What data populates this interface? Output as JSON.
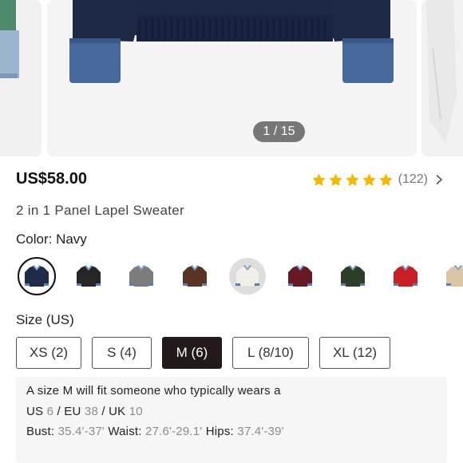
{
  "gallery": {
    "counter": "1 / 15"
  },
  "product": {
    "price": "US$58.00",
    "rating": {
      "stars": 5,
      "count": "(122)"
    },
    "title": "2 in 1 Panel Lapel Sweater"
  },
  "color": {
    "label": "Color: Navy",
    "swatches": [
      {
        "name": "Navy",
        "hex": "#1f2a48",
        "selected": true
      },
      {
        "name": "Black",
        "hex": "#262626"
      },
      {
        "name": "Grey",
        "hex": "#7c7c7c"
      },
      {
        "name": "Brown",
        "hex": "#5a3324"
      },
      {
        "name": "White",
        "hex": "#f1efe8"
      },
      {
        "name": "Burgundy",
        "hex": "#651a26"
      },
      {
        "name": "Green",
        "hex": "#2e3d26"
      },
      {
        "name": "Red",
        "hex": "#c81f26"
      },
      {
        "name": "Beige",
        "hex": "#d9c4a4"
      }
    ]
  },
  "size": {
    "label": "Size (US)",
    "options": [
      "XS (2)",
      "S (4)",
      "M (6)",
      "L (8/10)",
      "XL (12)"
    ],
    "selected": "M (6)"
  },
  "fit": {
    "line1": "A size M will fit someone who typically wears a",
    "us_label": "US",
    "us_value": "6",
    "eu_label": "EU",
    "eu_value": "38",
    "uk_label": "UK",
    "uk_value": "10",
    "bust_label": "Bust:",
    "bust_value": "35.4'-37'",
    "waist_label": "Waist:",
    "waist_value": "27.6'-29.1'",
    "hips_label": "Hips:",
    "hips_value": "37.4'-39'"
  },
  "colors": {
    "star": "#f5b800",
    "selected_size_bg": "#221a1a",
    "muted_value": "#8c8c8c"
  }
}
